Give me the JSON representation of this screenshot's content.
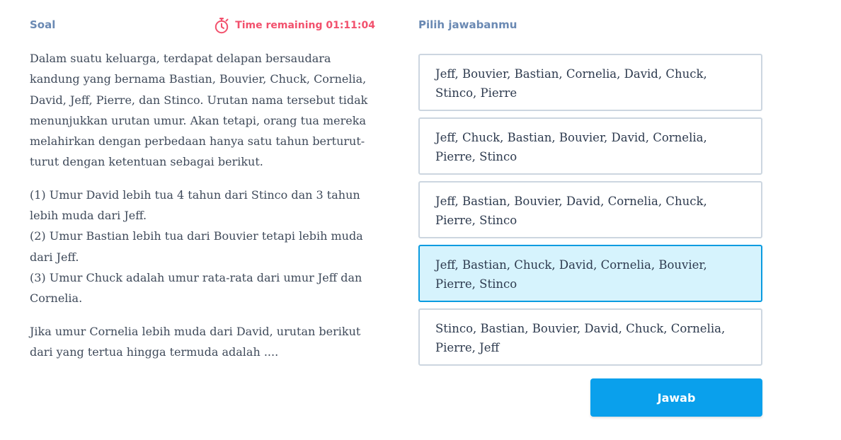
{
  "question_panel": {
    "label": "Soal",
    "timer": {
      "icon": "stopwatch-icon",
      "text": "Time remaining 01:11:04",
      "color": "#f2516d"
    },
    "paragraphs": [
      "Dalam suatu keluarga, terdapat delapan bersaudara kandung yang bernama Bastian, Bouvier, Chuck, Cornelia, David, Jeff, Pierre, dan Stinco. Urutan nama tersebut tidak menunjukkan urutan umur. Akan tetapi, orang tua mereka melahirkan dengan perbedaan hanya satu tahun berturut-turut dengan ketentuan sebagai berikut.",
      "",
      "Jika umur Cornelia lebih muda dari David, urutan berikut dari yang tertua hingga termuda adalah ...."
    ],
    "conditions": [
      "(1) Umur David lebih tua 4 tahun dari Stinco dan 3 tahun lebih muda dari Jeff.",
      "(2) Umur Bastian lebih tua dari Bouvier tetapi lebih muda dari Jeff.",
      "(3) Umur Chuck adalah umur rata-rata dari umur Jeff dan Cornelia."
    ]
  },
  "answer_panel": {
    "label": "Pilih jawabanmu",
    "selected_index": 3,
    "options": [
      "Jeff, Bouvier, Bastian, Cornelia, David, Chuck, Stinco, Pierre",
      "Jeff, Chuck, Bastian, Bouvier, David, Cornelia, Pierre, Stinco",
      "Jeff, Bastian, Bouvier, David, Cornelia, Chuck, Pierre, Stinco",
      "Jeff, Bastian, Chuck, David, Cornelia, Bouvier, Pierre, Stinco",
      "Stinco, Bastian, Bouvier, David, Chuck, Cornelia, Pierre, Jeff"
    ],
    "submit_label": "Jawab"
  },
  "colors": {
    "label": "#6a89b3",
    "selected_border": "#0a9be0",
    "selected_fill": "#d6f3fd",
    "button": "#0aa0ec"
  }
}
